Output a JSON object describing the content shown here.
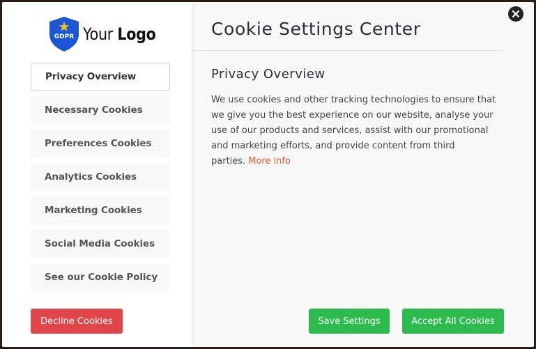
{
  "logo": {
    "badge_text": "GDPR",
    "text_regular": "Your ",
    "text_bold": "Logo",
    "shield_color": "#1a56d6",
    "star_color": "#f3c21b"
  },
  "nav": {
    "items": [
      {
        "label": "Privacy Overview",
        "active": true
      },
      {
        "label": "Necessary Cookies"
      },
      {
        "label": "Preferences Cookies"
      },
      {
        "label": "Analytics Cookies"
      },
      {
        "label": "Marketing Cookies"
      },
      {
        "label": "Social Media Cookies"
      },
      {
        "label": "See our Cookie Policy"
      }
    ]
  },
  "main": {
    "title": "Cookie Settings Center",
    "section_title": "Privacy Overview",
    "body": "We use cookies and other tracking technologies to ensure that we give you the best experience on our website, analyse your use of our products and services, assist with our promotional and marketing efforts, and provide content from third parties.",
    "more_link": "More info"
  },
  "buttons": {
    "decline": "Decline Cookies",
    "save": "Save Settings",
    "accept": "Accept All Cookies"
  },
  "colors": {
    "decline": "#e0454a",
    "accept": "#2dbb4e",
    "link": "#e55a2b"
  },
  "close_icon": "close-icon"
}
